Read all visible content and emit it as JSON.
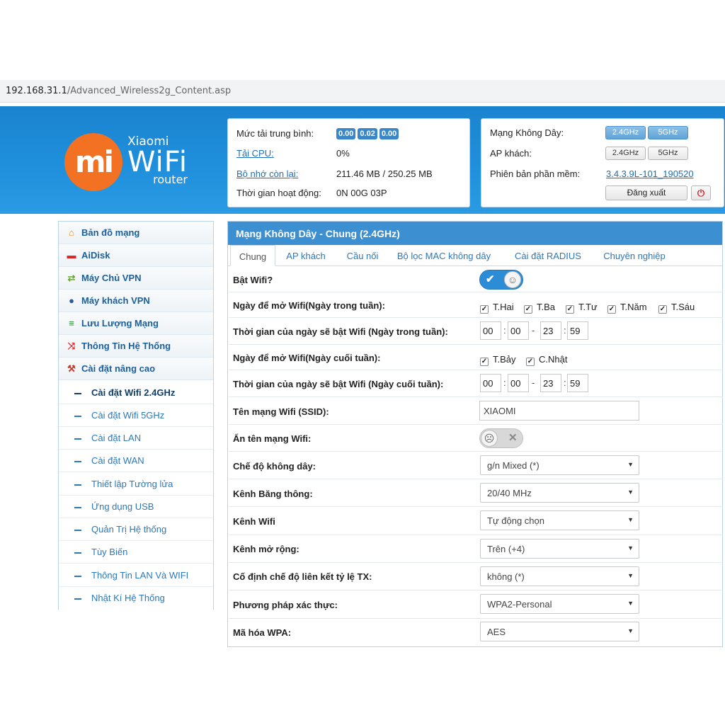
{
  "browser": {
    "host": "192.168.31.1",
    "path": "/Advanced_Wireless2g_Content.asp"
  },
  "logo": {
    "mark": "mi",
    "brand": "Xiaomi",
    "product": "WiFi",
    "sub": "router"
  },
  "status": {
    "avg_load_label": "Mức tải trung bình:",
    "avg_load": [
      "0.00",
      "0.02",
      "0.00"
    ],
    "cpu_label": "Tải CPU:",
    "cpu": "0%",
    "mem_label": "Bộ nhớ còn lại:",
    "mem": "211.46 MB / 250.25 MB",
    "uptime_label": "Thời gian hoạt động:",
    "uptime": "0N 00G 03P"
  },
  "quick": {
    "wireless_label": "Mạng Không Dây:",
    "guest_label": "AP khách:",
    "fw_label": "Phiên bản phần mềm:",
    "fw": "3.4.3.9L-101_190520",
    "band_24": "2.4GHz",
    "band_5": "5GHz",
    "logout": "Đăng xuất",
    "power_icon": "power-icon"
  },
  "sidebar": {
    "items": [
      {
        "label": "Bản đồ mạng",
        "icon": "home-icon"
      },
      {
        "label": "AiDisk",
        "icon": "disk-icon"
      },
      {
        "label": "Máy Chủ VPN",
        "icon": "vpn-server-icon"
      },
      {
        "label": "Máy khách VPN",
        "icon": "globe-icon"
      },
      {
        "label": "Lưu Lượng Mạng",
        "icon": "traffic-icon"
      },
      {
        "label": "Thông Tin Hệ Thống",
        "icon": "shuffle-icon"
      },
      {
        "label": "Cài đặt nâng cao",
        "icon": "wrench-icon"
      }
    ],
    "subitems": [
      "Cài đặt Wifi 2.4GHz",
      "Cài đặt Wifi 5GHz",
      "Cài đặt LAN",
      "Cài đặt WAN",
      "Thiết lập Tường lửa",
      "Ứng dụng USB",
      "Quản Trị Hệ thống",
      "Tùy Biến",
      "Thông Tin LAN Và WIFI",
      "Nhật Kí Hệ Thống"
    ]
  },
  "main": {
    "title": "Mạng Không Dây - Chung (2.4GHz)",
    "tabs": [
      "Chung",
      "AP khách",
      "Cầu nối",
      "Bộ lọc MAC không dây",
      "Cài đặt RADIUS",
      "Chuyên nghiệp"
    ],
    "wifi_on_label": "Bật Wifi?",
    "weekday_label": "Ngày để mở Wifi(Ngày trong tuần):",
    "weekdays": [
      "T.Hai",
      "T.Ba",
      "T.Tư",
      "T.Năm",
      "T.Sáu"
    ],
    "weekday_time_label": "Thời gian của ngày sẽ bật Wifi (Ngày trong tuần):",
    "weekday_time": [
      "00",
      "00",
      "23",
      "59"
    ],
    "weekend_label": "Ngày để mở Wifi(Ngày cuối tuần):",
    "weekend": [
      "T.Bảy",
      "C.Nhật"
    ],
    "weekend_time_label": "Thời gian của ngày sẽ bật Wifi (Ngày cuối tuần):",
    "weekend_time": [
      "00",
      "00",
      "23",
      "59"
    ],
    "ssid_label": "Tên mạng Wifi (SSID):",
    "ssid": "XIAOMI",
    "hide_label": "Ẩn tên mạng Wifi:",
    "mode_label": "Chế độ không dây:",
    "mode": "g/n Mixed (*)",
    "bw_label": "Kênh Băng thông:",
    "bw": "20/40 MHz",
    "channel_label": "Kênh Wifi",
    "channel": "Tự động chọn",
    "ext_label": "Kênh mở rộng:",
    "ext": "Trên (+4)",
    "tx_label": "Cố định chế độ liên kết tỷ lệ TX:",
    "tx": "không (*)",
    "auth_label": "Phương pháp xác thực:",
    "auth": "WPA2-Personal",
    "enc_label": "Mã hóa WPA:",
    "enc": "AES",
    "time_sep": "-",
    "time_colon": ":"
  },
  "colors": {
    "header_blue": "#1f8fdc",
    "accent": "#3c8fd1",
    "logo_orange": "#f27122",
    "power_red": "#d9252a"
  }
}
